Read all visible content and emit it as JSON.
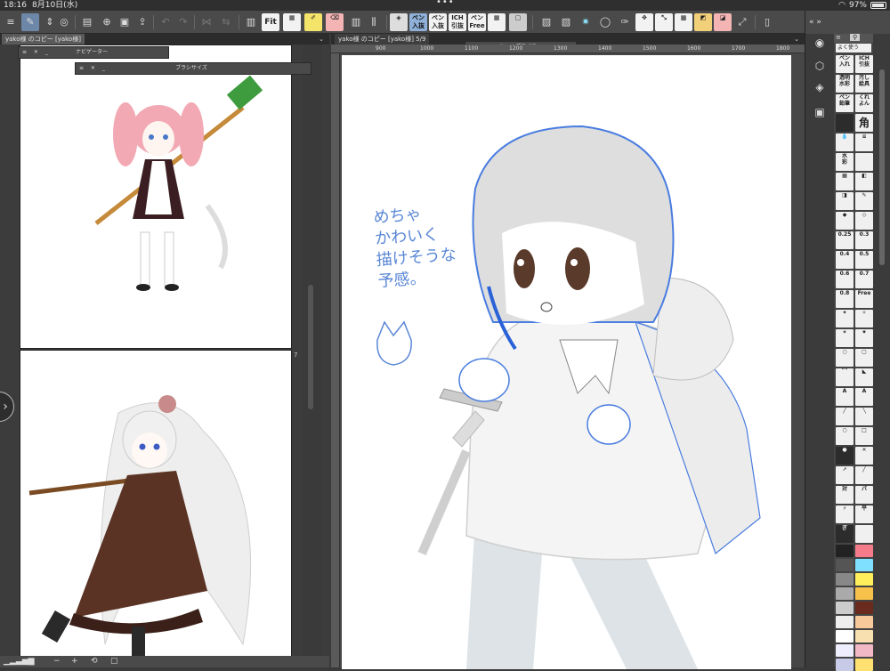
{
  "status": {
    "time": "18:16",
    "date": "8月10日(水)",
    "battery": "97%"
  },
  "toolbar": {
    "left_icons": [
      "menu-icon",
      "pen-icon",
      "lasso-icon",
      "brush-icon"
    ],
    "labels": {
      "fit": "Fit",
      "pen_nyuki": "ペン\n入抜",
      "pen_nyuki_2": "ペン\n入抜",
      "ichi_hiki": "ICH\n引抜",
      "pen_free": "ペン\nFree"
    }
  },
  "tabs": {
    "left": "yako様 のコピー [yako様]",
    "right": "yako様 のコピー [yako様] 5/9"
  },
  "float_windows": {
    "navigator": "ナビゲーター",
    "brush_size": "ブラシサイズ",
    "tool_property": "ツールプロパティ"
  },
  "page_number": "7",
  "ruler": [
    "900",
    "1000",
    "1100",
    "1200",
    "1300",
    "1400",
    "1500",
    "1600",
    "1700",
    "1800"
  ],
  "handwritten_note": "めちゃ\nかわいく\n描けそうな\n予感。",
  "palette": {
    "tab_label": "よく使う",
    "cells": [
      {
        "t": "ペン\n入れ"
      },
      {
        "t": "ICH\n引抜"
      },
      {
        "t": "透明\n水彩"
      },
      {
        "t": "汚し\n絵具"
      },
      {
        "t": "ペン\n鉛筆"
      },
      {
        "t": "くれ\nよん"
      },
      {
        "t": "",
        "dark": true
      },
      {
        "t": "角",
        "big": true
      },
      {
        "t": "💧"
      },
      {
        "t": "≡"
      },
      {
        "t": "水\n彩"
      },
      {
        "t": ""
      },
      {
        "t": "▦"
      },
      {
        "t": "◧"
      },
      {
        "t": "◨"
      },
      {
        "t": "✎"
      },
      {
        "t": "◆"
      },
      {
        "t": "◇"
      },
      {
        "t": "0.25"
      },
      {
        "t": "0.3"
      },
      {
        "t": "0.4"
      },
      {
        "t": "0.5"
      },
      {
        "t": "0.6"
      },
      {
        "t": "0.7"
      },
      {
        "t": "0.8"
      },
      {
        "t": "Free"
      },
      {
        "t": "✦"
      },
      {
        "t": "✧"
      },
      {
        "t": "✶"
      },
      {
        "t": "✷"
      },
      {
        "t": "○"
      },
      {
        "t": "▢"
      },
      {
        "t": "⌒"
      },
      {
        "t": "◣"
      },
      {
        "t": "A"
      },
      {
        "t": "A"
      },
      {
        "t": "╱"
      },
      {
        "t": "╲"
      },
      {
        "t": "○"
      },
      {
        "t": "□"
      },
      {
        "t": "●",
        "dark": true
      },
      {
        "t": "✕"
      },
      {
        "t": "➚"
      },
      {
        "t": "╱"
      },
      {
        "t": "対"
      },
      {
        "t": "パ"
      },
      {
        "t": "⚡"
      },
      {
        "t": "平"
      },
      {
        "t": "ぎ",
        "dark": true
      },
      {
        "t": ""
      }
    ],
    "colors": [
      "#222222",
      "#f47c8a",
      "#555555",
      "#7fe0ff",
      "#888888",
      "#ffef5a",
      "#aaaaaa",
      "#f8c24a",
      "#cccccc",
      "#6b2a1e",
      "#eeeeee",
      "#f6c89a",
      "#ffffff",
      "#f9e0b0",
      "#eeeeff",
      "#f2b8c6",
      "#c8cbe8",
      "#ffe070"
    ]
  }
}
